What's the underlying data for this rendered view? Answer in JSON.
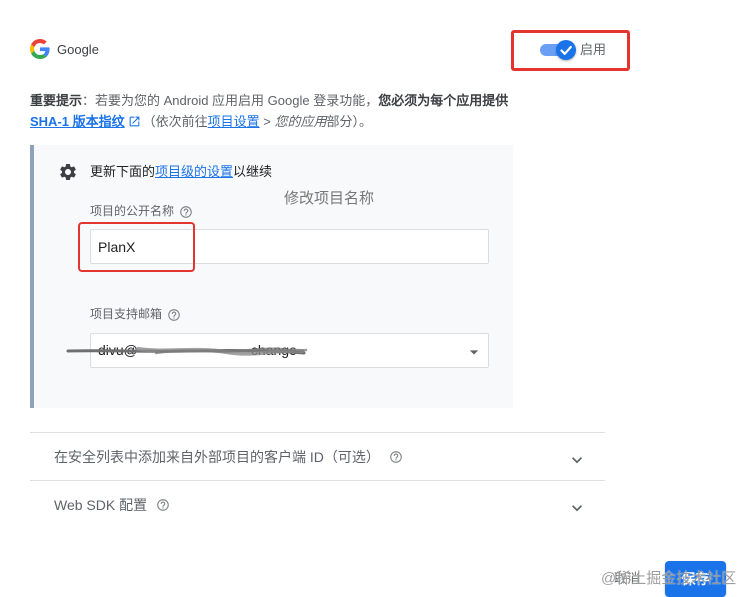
{
  "header": {
    "provider_icon": "google-g-logo",
    "provider_name": "Google",
    "toggle": {
      "label": "启用",
      "enabled": true,
      "icon": "check-icon"
    }
  },
  "notice": {
    "line1": {
      "bold_prefix": "重要提示",
      "text": "：若要为您的 Android 应用启用 Google 登录功能，",
      "bold_suffix": "您必须为每个应用提供"
    },
    "line2": {
      "sha_link": "SHA-1 版本指纹",
      "sha_link_icon": "open-in-new-icon",
      "before_settings": "（依次前往",
      "settings_link": "项目设置",
      "separator": " > ",
      "your_apps": "您的应用",
      "after": "部分）。"
    }
  },
  "project_settings": {
    "icon": "gear-icon",
    "heading_prefix": "更新下面的",
    "heading_link": "项目级的设置",
    "heading_suffix": "以继续",
    "public_name": {
      "label": "项目的公开名称",
      "value": "PlanX",
      "help_icon": "help-icon"
    },
    "support_email": {
      "label": "项目支持邮箱",
      "value_visible_start": "divu@",
      "value_visible_end": "change",
      "help_icon": "help-icon",
      "dropdown_icon": "arrow-drop-down-icon"
    }
  },
  "annotations": {
    "rename_hint": "修改项目名称"
  },
  "expansion_panels": [
    {
      "title": "在安全列表中添加来自外部项目的客户端 ID（可选）",
      "help_icon": "help-icon",
      "expand_icon": "chevron-down-icon"
    },
    {
      "title": "Web SDK 配置",
      "help_icon": "help-icon",
      "expand_icon": "chevron-down-icon"
    }
  ],
  "footer": {
    "cancel_label": "取消",
    "save_label": "保存"
  },
  "watermark": "@稀土掘金技术社区",
  "colors": {
    "accent": "#1a73e8",
    "annotation_red": "#e3342f",
    "panel_background": "#f8f9fa",
    "panel_bar": "#8fa3b8"
  }
}
